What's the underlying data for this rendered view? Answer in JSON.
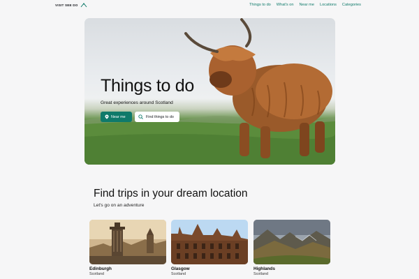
{
  "brand": {
    "logo_text": "VISIT SEE DO"
  },
  "nav": {
    "items": [
      "Things to do",
      "What's on",
      "Near me",
      "Locations",
      "Categories"
    ]
  },
  "hero": {
    "title": "Things to do",
    "subtitle": "Great experiences around Scotland",
    "near_me_label": "Near me",
    "find_label": "Find things to do"
  },
  "locations": {
    "title": "Find trips in your dream location",
    "subtitle": "Let's go on an adventure",
    "cards": [
      {
        "name": "Edinburgh",
        "region": "Scotland"
      },
      {
        "name": "Glasgow",
        "region": "Scotland"
      },
      {
        "name": "Highlands",
        "region": "Scotland"
      }
    ]
  },
  "colors": {
    "accent": "#0f7a6a"
  },
  "icons": {
    "logo": "thistle-icon",
    "near_me": "map-pin-icon",
    "find": "search-icon"
  }
}
